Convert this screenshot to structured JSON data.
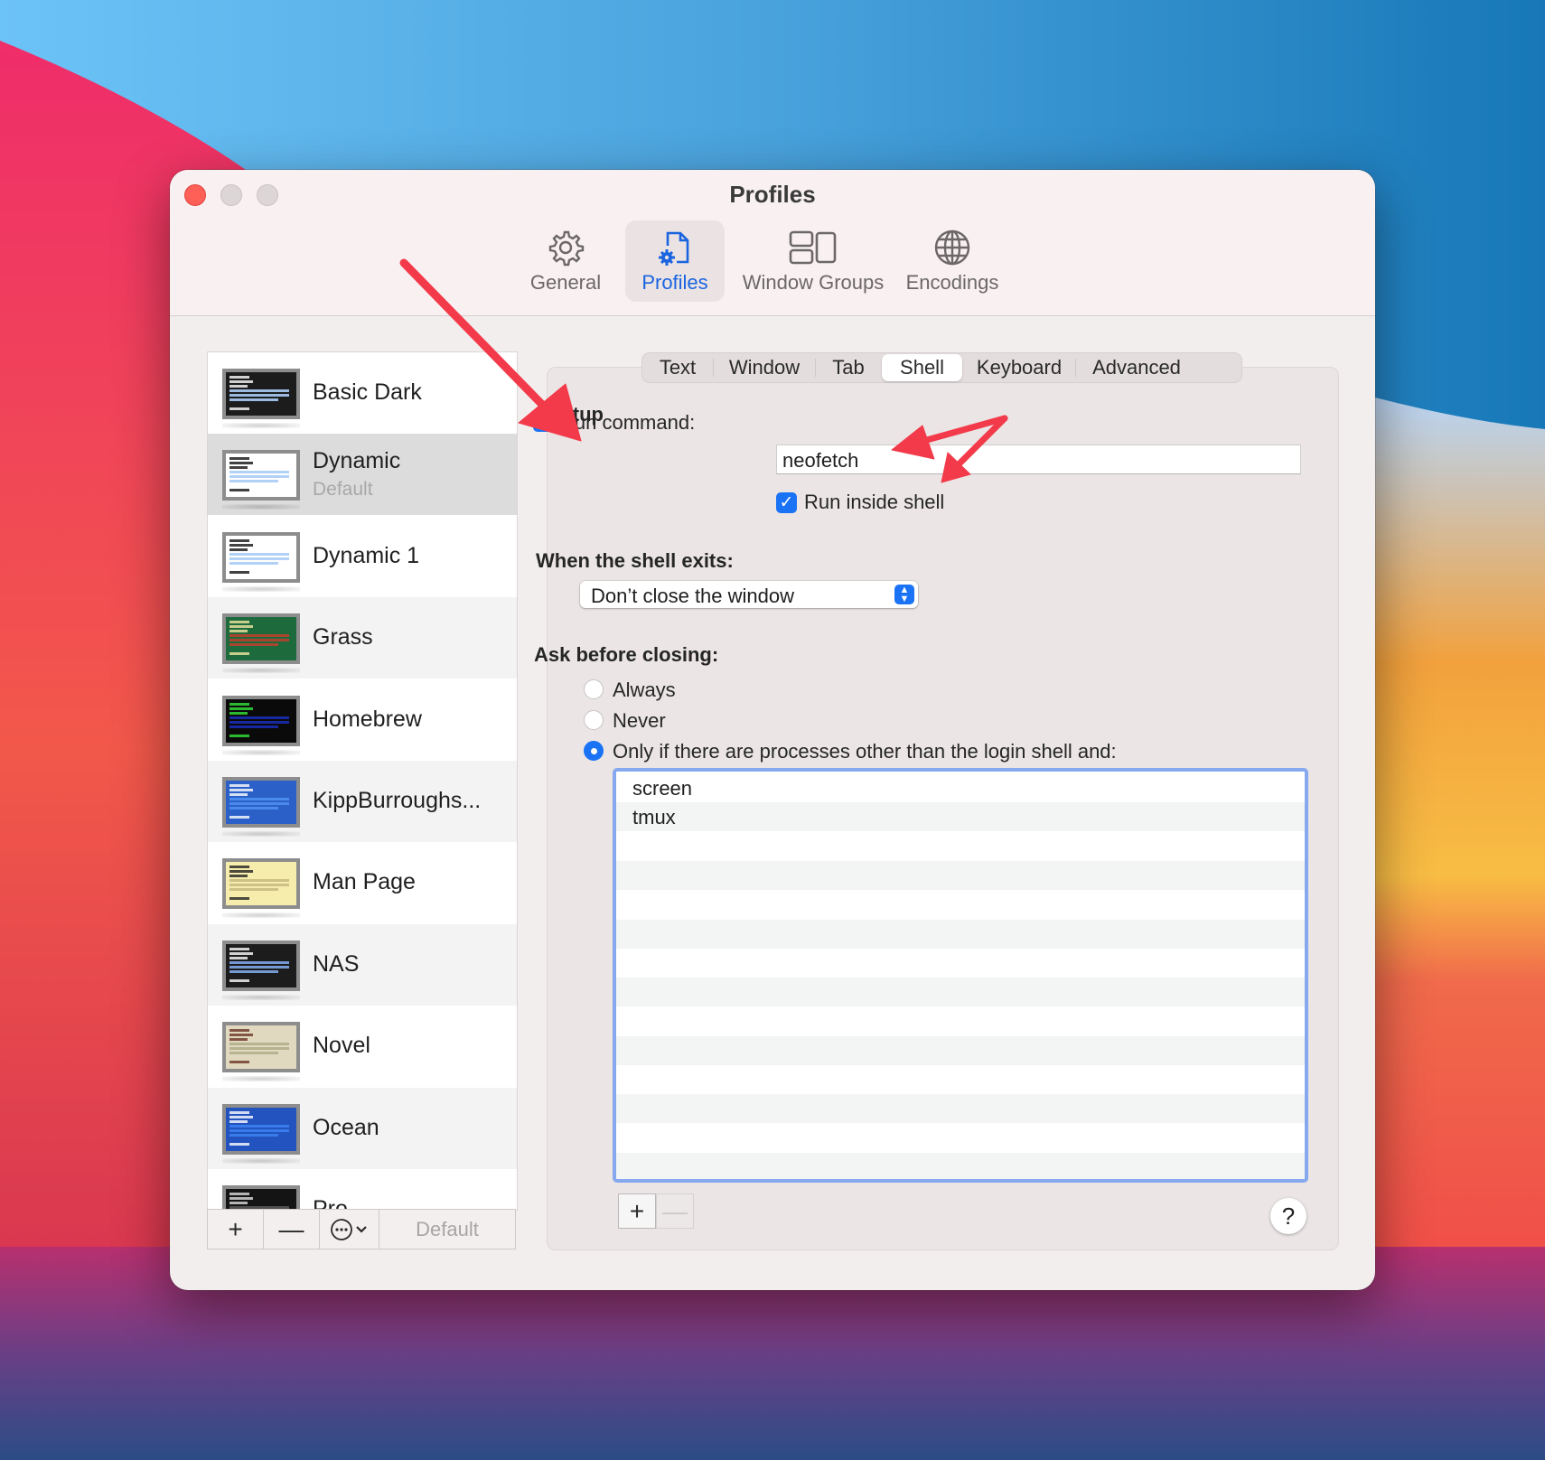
{
  "window": {
    "title": "Profiles",
    "traffic_lights": [
      "close",
      "minimize",
      "zoom"
    ]
  },
  "toolbar": {
    "items": [
      {
        "label": "General",
        "icon": "gear-icon",
        "selected": false
      },
      {
        "label": "Profiles",
        "icon": "profile-document-gear-icon",
        "selected": true
      },
      {
        "label": "Window Groups",
        "icon": "window-groups-icon",
        "selected": false
      },
      {
        "label": "Encodings",
        "icon": "globe-icon",
        "selected": false
      }
    ],
    "accent_color": "#1a64e0"
  },
  "sidebar": {
    "profiles": [
      {
        "name": "Basic Dark",
        "subtitle": "",
        "theme_bg": "#1c1c1c",
        "theme_fg": "#ffffff",
        "theme_hl": "#a9cdf5"
      },
      {
        "name": "Dynamic",
        "subtitle": "Default",
        "theme_bg": "#ffffff",
        "theme_fg": "#111111",
        "theme_hl": "#a9cdf5",
        "selected": true
      },
      {
        "name": "Dynamic 1",
        "subtitle": "",
        "theme_bg": "#ffffff",
        "theme_fg": "#111111",
        "theme_hl": "#a9cdf5"
      },
      {
        "name": "Grass",
        "subtitle": "",
        "theme_bg": "#1d6b3c",
        "theme_fg": "#f2e6a0",
        "theme_hl": "#b9412c"
      },
      {
        "name": "Homebrew",
        "subtitle": "",
        "theme_bg": "#0a0a0a",
        "theme_fg": "#33e33a",
        "theme_hl": "#1a2bb0"
      },
      {
        "name": "KippBurroughs...",
        "subtitle": "",
        "theme_bg": "#2a60c8",
        "theme_fg": "#ffffff",
        "theme_hl": "#4d8ff0"
      },
      {
        "name": "Man Page",
        "subtitle": "",
        "theme_bg": "#f6ecab",
        "theme_fg": "#222222",
        "theme_hl": "#c9bd82"
      },
      {
        "name": "NAS",
        "subtitle": "",
        "theme_bg": "#1c1c1c",
        "theme_fg": "#ffffff",
        "theme_hl": "#7fa8e8"
      },
      {
        "name": "Novel",
        "subtitle": "",
        "theme_bg": "#e0d9bf",
        "theme_fg": "#6b3424",
        "theme_hl": "#b3ad8b"
      },
      {
        "name": "Ocean",
        "subtitle": "",
        "theme_bg": "#2353be",
        "theme_fg": "#ffffff",
        "theme_hl": "#3b7ff0"
      },
      {
        "name": "Pro",
        "subtitle": "",
        "theme_bg": "#141414",
        "theme_fg": "#dddddd",
        "theme_hl": "#555555"
      }
    ],
    "bottom_bar": {
      "add_label": "+",
      "remove_label": "—",
      "more_label": "⋯",
      "default_label": "Default"
    }
  },
  "tabs": {
    "items": [
      "Text",
      "Window",
      "Tab",
      "Shell",
      "Keyboard",
      "Advanced"
    ],
    "selected": "Shell"
  },
  "shell": {
    "startup_heading": "Startup",
    "run_command_label": "Run command:",
    "run_command_checked": true,
    "run_command_value": "neofetch",
    "run_inside_shell_label": "Run inside shell",
    "run_inside_shell_checked": true,
    "exit_heading": "When the shell exits:",
    "exit_selected": "Don’t close the window",
    "ask_heading": "Ask before closing:",
    "ask_options": [
      {
        "label": "Always",
        "selected": false
      },
      {
        "label": "Never",
        "selected": false
      },
      {
        "label": "Only if there are processes other than the login shell and:",
        "selected": true
      }
    ],
    "process_list": [
      "screen",
      "tmux"
    ],
    "process_add_label": "+",
    "process_remove_label": "—",
    "help_label": "?"
  },
  "colors": {
    "checkbox_blue": "#1a73f5",
    "list_focus_border": "#86a8ef",
    "annotation_red": "#f23a4a"
  }
}
